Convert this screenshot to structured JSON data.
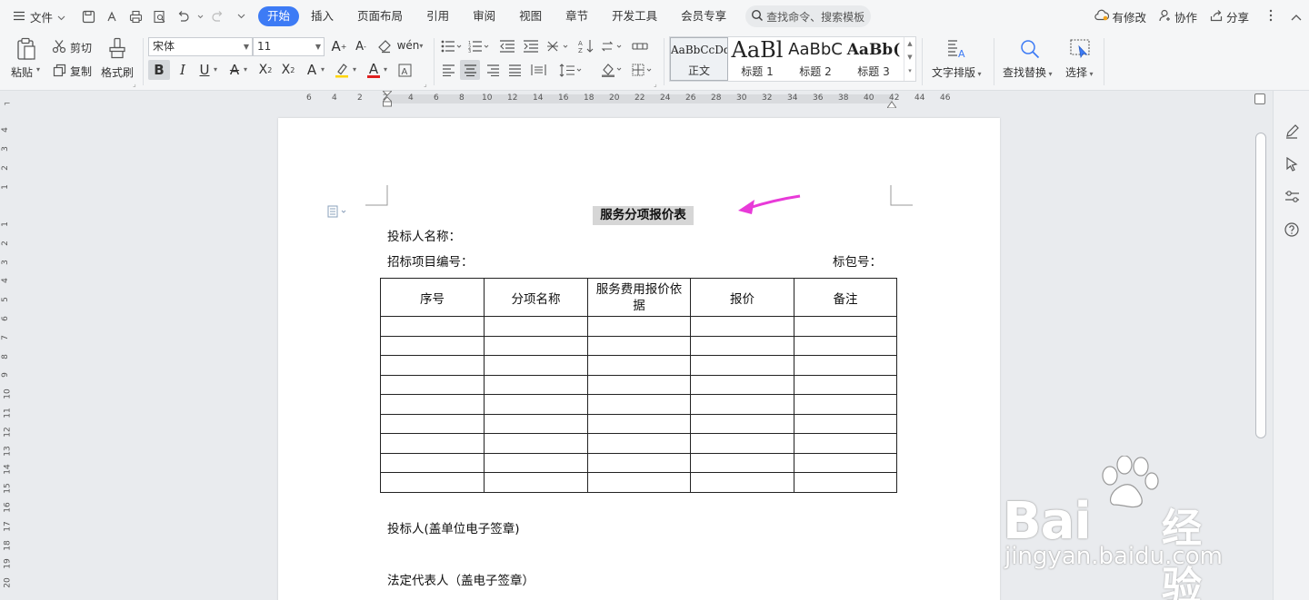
{
  "menubar": {
    "file_label": "文件",
    "tabs": [
      {
        "label": "开始",
        "active": true
      },
      {
        "label": "插入"
      },
      {
        "label": "页面布局"
      },
      {
        "label": "引用"
      },
      {
        "label": "审阅"
      },
      {
        "label": "视图"
      },
      {
        "label": "章节"
      },
      {
        "label": "开发工具"
      },
      {
        "label": "会员专享"
      }
    ],
    "search_label": "查找命令、搜索模板",
    "right": {
      "modified": "有修改",
      "collab": "协作",
      "share": "分享"
    }
  },
  "ribbon": {
    "paste": "粘贴",
    "cut": "剪切",
    "copy": "复制",
    "format_painter": "格式刷",
    "font_name": "宋体",
    "font_size": "11",
    "bold": "B",
    "italic": "I",
    "underline": "U",
    "styles": [
      {
        "preview": "AaBbCcDd",
        "name": "正文"
      },
      {
        "preview": "AaBl",
        "name": "标题 1"
      },
      {
        "preview": "AaBbC",
        "name": "标题 2"
      },
      {
        "preview": "AaBb(",
        "name": "标题 3"
      }
    ],
    "text_layout": "文字排版",
    "find_replace": "查找替换",
    "select": "选择"
  },
  "ruler": {
    "h_ticks": [
      "6",
      "4",
      "2",
      "2",
      "4",
      "6",
      "8",
      "10",
      "12",
      "14",
      "16",
      "18",
      "20",
      "22",
      "24",
      "26",
      "28",
      "30",
      "32",
      "34",
      "36",
      "38",
      "40",
      "42",
      "44",
      "46"
    ],
    "v_ticks": [
      "4",
      "3",
      "2",
      "1",
      "1",
      "2",
      "3",
      "4",
      "5",
      "6",
      "7",
      "8",
      "9",
      "10",
      "11",
      "12",
      "13",
      "14",
      "15",
      "16",
      "17",
      "18",
      "19",
      "20"
    ]
  },
  "document": {
    "title": "服务分项报价表",
    "bidder_name": "投标人名称：",
    "project_no": "招标项目编号：",
    "package_no": "标包号：",
    "table": {
      "headers": [
        "序号",
        "分项名称",
        "服务费用报价依据",
        "报价",
        "备注"
      ],
      "empty_rows": 9
    },
    "seal_line": "投标人(盖单位电子签章)",
    "legal_rep": "法定代表人（盖电子签章）"
  },
  "watermark": {
    "brand": "Bai",
    "brand_cn": "经验",
    "url": "jingyan.baidu.com"
  },
  "colors": {
    "accent": "#3d7bf5",
    "arrow": "#e83ad8",
    "title_highlight": "#d6d6d6"
  }
}
